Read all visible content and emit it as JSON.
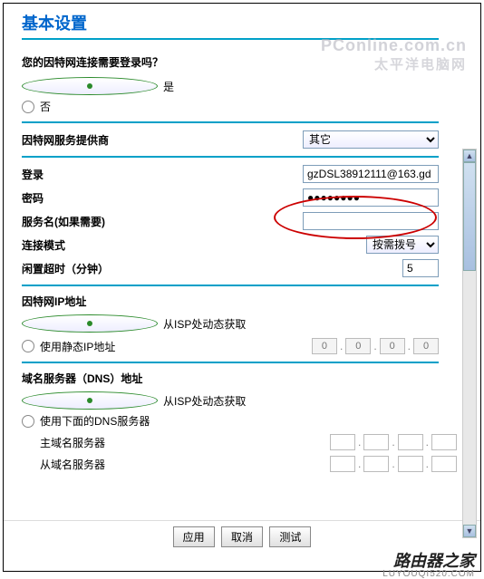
{
  "title": "基本设置",
  "watermarks": {
    "top1": "PConline.com.cn",
    "top2": "太平洋电脑网",
    "bottom1": "路由器之家",
    "bottom2": "LUYOUQI520.COM"
  },
  "login_question": "您的因特网连接需要登录吗？",
  "yes": "是",
  "no": "否",
  "isp_label": "因特网服务提供商",
  "isp_value": "其它",
  "login_label": "登录",
  "login_value": "gzDSL38912111@163.gd",
  "password_label": "密码",
  "password_value": "●●●●●●●●",
  "service_label": "服务名(如果需要)",
  "service_value": "",
  "conn_mode_label": "连接模式",
  "conn_mode_value": "按需拨号",
  "idle_label": "闲置超时（分钟）",
  "idle_value": "5",
  "ip_section": "因特网IP地址",
  "ip_dynamic": "从ISP处动态获取",
  "ip_static": "使用静态IP地址",
  "dns_section": "域名服务器（DNS）地址",
  "dns_dynamic": "从ISP处动态获取",
  "dns_custom": "使用下面的DNS服务器",
  "dns_primary": "主域名服务器",
  "dns_secondary": "从域名服务器",
  "ip_placeholder": "0",
  "btn_apply": "应用",
  "btn_cancel": "取消",
  "btn_test": "测试"
}
